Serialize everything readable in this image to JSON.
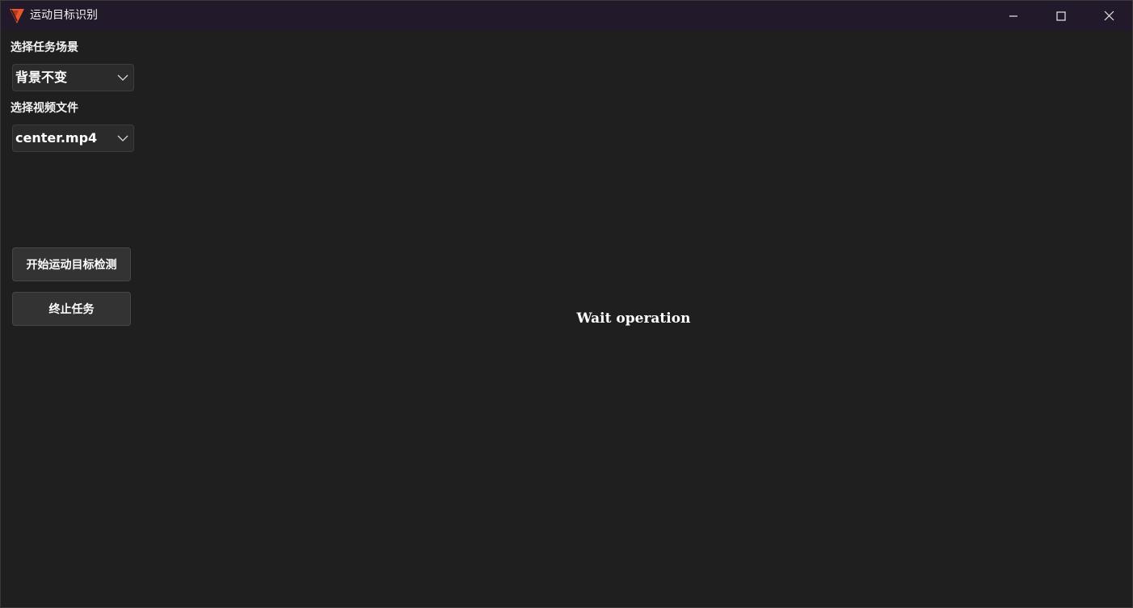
{
  "window": {
    "title": "运动目标识别",
    "controls": {
      "minimize_icon": "minimize-icon",
      "maximize_icon": "maximize-icon",
      "close_icon": "close-icon"
    }
  },
  "sidebar": {
    "scene_label": "选择任务场景",
    "scene_select": {
      "value": "背景不变"
    },
    "video_label": "选择视频文件",
    "video_select": {
      "value": "center.mp4"
    },
    "start_button": "开始运动目标检测",
    "stop_button": "终止任务"
  },
  "main": {
    "status": "Wait operation"
  },
  "colors": {
    "titlebar": "#221a2b",
    "background": "#1f1f1f",
    "icon_accent": "#e8552e"
  }
}
